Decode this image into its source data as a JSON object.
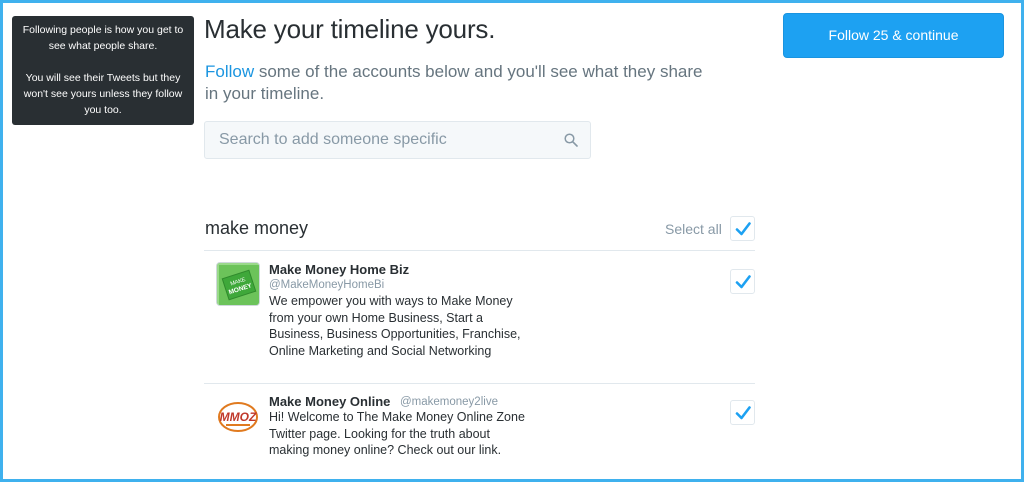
{
  "tooltip": {
    "line1": "Following people is how you get to see what people share.",
    "line2": "You will see their Tweets but they won't see yours unless they follow you too."
  },
  "header": {
    "title": "Make your timeline yours.",
    "subtitle_link": "Follow",
    "subtitle_rest": " some of the accounts below and you'll see what they share in your timeline."
  },
  "search": {
    "placeholder": "Search to add someone specific"
  },
  "cta": {
    "label": "Follow 25 & continue"
  },
  "section": {
    "title": "make money",
    "select_all_label": "Select all",
    "select_all_checked": true
  },
  "accounts": [
    {
      "name": "Make Money Home Biz",
      "handle": "@MakeMoneyHomeBi",
      "bio": "We empower you with ways to Make Money from your own Home Business, Start a Business, Business Opportunities, Franchise, Online Marketing and Social Networking",
      "avatar_text": "MAKE MONEY",
      "checked": true
    },
    {
      "name": "Make Money Online",
      "handle": "@makemoney2live",
      "bio": "Hi! Welcome to The Make Money Online Zone Twitter page. Looking for the truth about making money online? Check out our link.",
      "avatar_text": "MMOZ",
      "checked": true
    }
  ],
  "colors": {
    "accent": "#1da1f2",
    "link": "#1b95e0",
    "frame": "#3fb1ee",
    "tooltip_bg": "#292f33"
  }
}
